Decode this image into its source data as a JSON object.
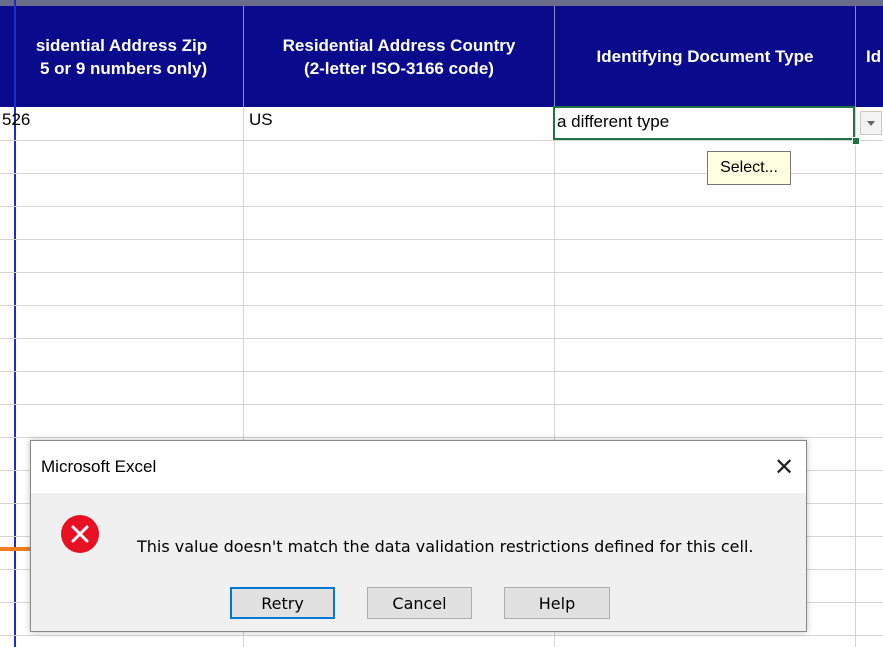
{
  "columns": [
    {
      "line1": "sidential Address Zip",
      "line2": "5 or 9 numbers only)"
    },
    {
      "line1": "Residential Address Country",
      "line2": "(2-letter ISO-3166 code)"
    },
    {
      "line1": "Identifying Document Type",
      "line2": ""
    },
    {
      "line1": "Id",
      "line2": ""
    }
  ],
  "row1": {
    "zip": "526",
    "country": "US",
    "doc_type": "a different type"
  },
  "tooltip": "Select...",
  "dialog": {
    "title": "Microsoft Excel",
    "close_glyph": "✕",
    "message": "This value doesn't match the data validation restrictions defined for this cell.",
    "icon": "error-icon",
    "buttons": {
      "retry": "Retry",
      "cancel": "Cancel",
      "help": "Help"
    }
  },
  "colors": {
    "header_bg": "#0a0a8c",
    "active_cell_border": "#217346",
    "error_red": "#e81123",
    "arrow": "#f07d1e"
  }
}
